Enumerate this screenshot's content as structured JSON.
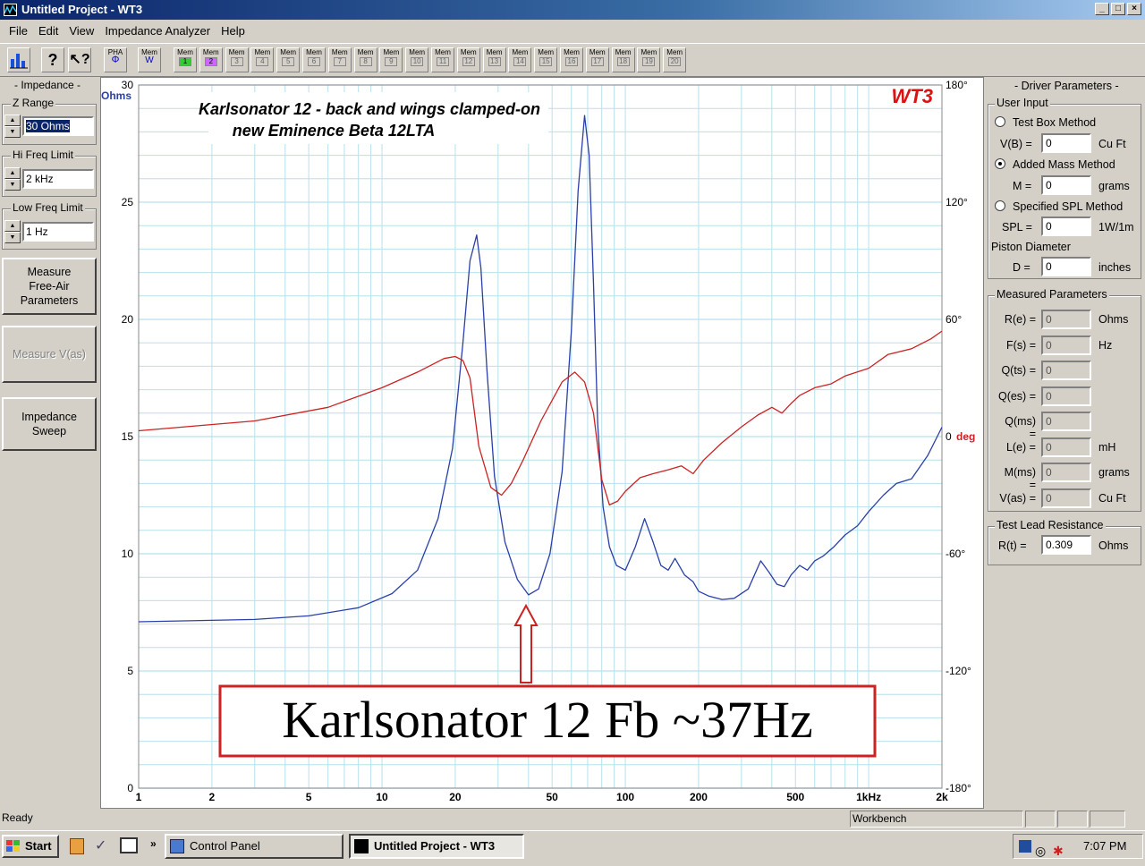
{
  "window": {
    "title": "Untitled Project - WT3"
  },
  "menu": [
    "File",
    "Edit",
    "View",
    "Impedance Analyzer",
    "Help"
  ],
  "toolbar": {
    "pha": {
      "top": "PHA",
      "bottom": "Φ"
    },
    "memw": {
      "top": "Mem",
      "bottom": "W"
    },
    "mem_label": "Mem",
    "mem_slots": [
      "1",
      "2",
      "3",
      "4",
      "5",
      "6",
      "7",
      "8",
      "9",
      "10",
      "11",
      "12",
      "13",
      "14",
      "15",
      "16",
      "17",
      "18",
      "19",
      "20"
    ]
  },
  "left_panel": {
    "impedance_label": "- Impedance -",
    "z_range": {
      "label": "Z Range",
      "value": "30 Ohms"
    },
    "hi_freq": {
      "label": "Hi Freq Limit",
      "value": "2 kHz"
    },
    "low_freq": {
      "label": "Low Freq Limit",
      "value": "1 Hz"
    },
    "measure_free_air": "Measure Free-Air Parameters",
    "measure_vas": "Measure V(as)",
    "impedance_sweep": "Impedance Sweep"
  },
  "plot": {
    "title_line1": "Karlsonator 12 - back and wings clamped-on",
    "title_line2": "new Eminence Beta 12LTA",
    "brand": "WT3",
    "annotation": "Karlsonator 12 Fb ~37Hz",
    "left_unit": "Ohms",
    "right_unit": "deg",
    "colors": {
      "impedance": "#2a3fa8",
      "phase": "#cc2222",
      "grid": "#b8e0ec",
      "annotation": "#cc2222"
    }
  },
  "chart_data": {
    "type": "line",
    "xscale": "log",
    "xlim": [
      1,
      2000
    ],
    "x_ticks": [
      1,
      2,
      5,
      10,
      20,
      50,
      100,
      200,
      500,
      1000,
      2000
    ],
    "x_tick_labels": [
      "1",
      "2",
      "5",
      "10",
      "20",
      "50",
      "100",
      "200",
      "500",
      "1kHz",
      "2k"
    ],
    "ylim": [
      0,
      30
    ],
    "y_ticks": [
      0,
      5,
      10,
      15,
      20,
      25,
      30
    ],
    "y2lim": [
      -180,
      180
    ],
    "y2_ticks": [
      -180,
      -120,
      -60,
      0,
      60,
      120,
      180
    ],
    "y2_tick_labels": [
      "-180°",
      "-120°",
      "-60°",
      "0",
      "60°",
      "120°",
      "180°"
    ],
    "series": [
      {
        "axis": "left",
        "x": [
          1,
          3,
          5,
          8,
          11,
          14,
          17,
          19.5,
          21.5,
          23,
          24.5,
          25.5,
          27,
          29,
          32,
          36,
          40,
          44,
          49,
          55,
          60,
          64,
          68,
          71,
          74,
          77,
          81,
          86,
          92,
          100,
          110,
          120,
          130,
          140,
          150,
          160,
          175,
          190,
          200,
          220,
          250,
          280,
          320,
          360,
          390,
          420,
          450,
          480,
          520,
          560,
          600,
          650,
          720,
          800,
          900,
          1000,
          1150,
          1300,
          1500,
          1750,
          2000
        ],
        "y": [
          7.1,
          7.2,
          7.35,
          7.7,
          8.3,
          9.3,
          11.5,
          14.5,
          19.0,
          22.5,
          23.6,
          22.2,
          17.8,
          13.3,
          10.5,
          8.9,
          8.25,
          8.5,
          10.0,
          13.5,
          19.5,
          25.5,
          28.7,
          27.0,
          21.5,
          15.5,
          12.0,
          10.3,
          9.5,
          9.3,
          10.3,
          11.5,
          10.5,
          9.5,
          9.3,
          9.8,
          9.1,
          8.8,
          8.4,
          8.2,
          8.05,
          8.1,
          8.5,
          9.7,
          9.2,
          8.7,
          8.6,
          9.1,
          9.5,
          9.3,
          9.7,
          9.9,
          10.3,
          10.8,
          11.2,
          11.8,
          12.5,
          13.0,
          13.2,
          14.2,
          15.4
        ]
      },
      {
        "axis": "right",
        "x": [
          1,
          3,
          6,
          10,
          14,
          18,
          20,
          21.5,
          23,
          25,
          28,
          31,
          34,
          38,
          45,
          55,
          62,
          68,
          74,
          80,
          86,
          93,
          100,
          115,
          130,
          150,
          170,
          190,
          210,
          250,
          300,
          350,
          400,
          440,
          480,
          520,
          600,
          700,
          800,
          1000,
          1200,
          1500,
          1800,
          2000
        ],
        "y": [
          3,
          8,
          15,
          25,
          33,
          40,
          41,
          39,
          30,
          -5,
          -26,
          -30,
          -24,
          -12,
          8,
          28,
          33,
          28,
          12,
          -22,
          -35,
          -33,
          -28,
          -21,
          -19,
          -17,
          -15,
          -19,
          -12,
          -3,
          5,
          11,
          15,
          12,
          17,
          21,
          25,
          27,
          31,
          35,
          42,
          45,
          50,
          54
        ]
      }
    ]
  },
  "right_panel": {
    "driver_label": "- Driver Parameters -",
    "user_input": "User Input",
    "test_box": "Test Box Method",
    "vb": {
      "label": "V(B) =",
      "value": "0",
      "unit": "Cu Ft"
    },
    "added_mass": "Added Mass Method",
    "m": {
      "label": "M =",
      "value": "0",
      "unit": "grams"
    },
    "spl_method": "Specified SPL Method",
    "spl": {
      "label": "SPL =",
      "value": "0",
      "unit": "1W/1m"
    },
    "piston": "Piston Diameter",
    "d": {
      "label": "D =",
      "value": "0",
      "unit": "inches"
    },
    "measured_label": "Measured Parameters",
    "measured": [
      {
        "label": "R(e) =",
        "value": "0",
        "unit": "Ohms"
      },
      {
        "label": "F(s) =",
        "value": "0",
        "unit": "Hz"
      },
      {
        "label": "Q(ts) =",
        "value": "0",
        "unit": ""
      },
      {
        "label": "Q(es) =",
        "value": "0",
        "unit": ""
      },
      {
        "label": "Q(ms) =",
        "value": "0",
        "unit": ""
      },
      {
        "label": "L(e) =",
        "value": "0",
        "unit": "mH"
      },
      {
        "label": "M(ms) =",
        "value": "0",
        "unit": "grams"
      },
      {
        "label": "V(as) =",
        "value": "0",
        "unit": "Cu Ft"
      }
    ],
    "test_lead_label": "Test Lead Resistance",
    "rt": {
      "label": "R(t) =",
      "value": "0.309",
      "unit": "Ohms"
    }
  },
  "status": {
    "ready": "Ready",
    "workbench": "Workbench"
  },
  "taskbar": {
    "start": "Start",
    "control_panel": "Control Panel",
    "active_window": "Untitled Project - WT3",
    "clock": "7:07 PM",
    "more": "»"
  }
}
